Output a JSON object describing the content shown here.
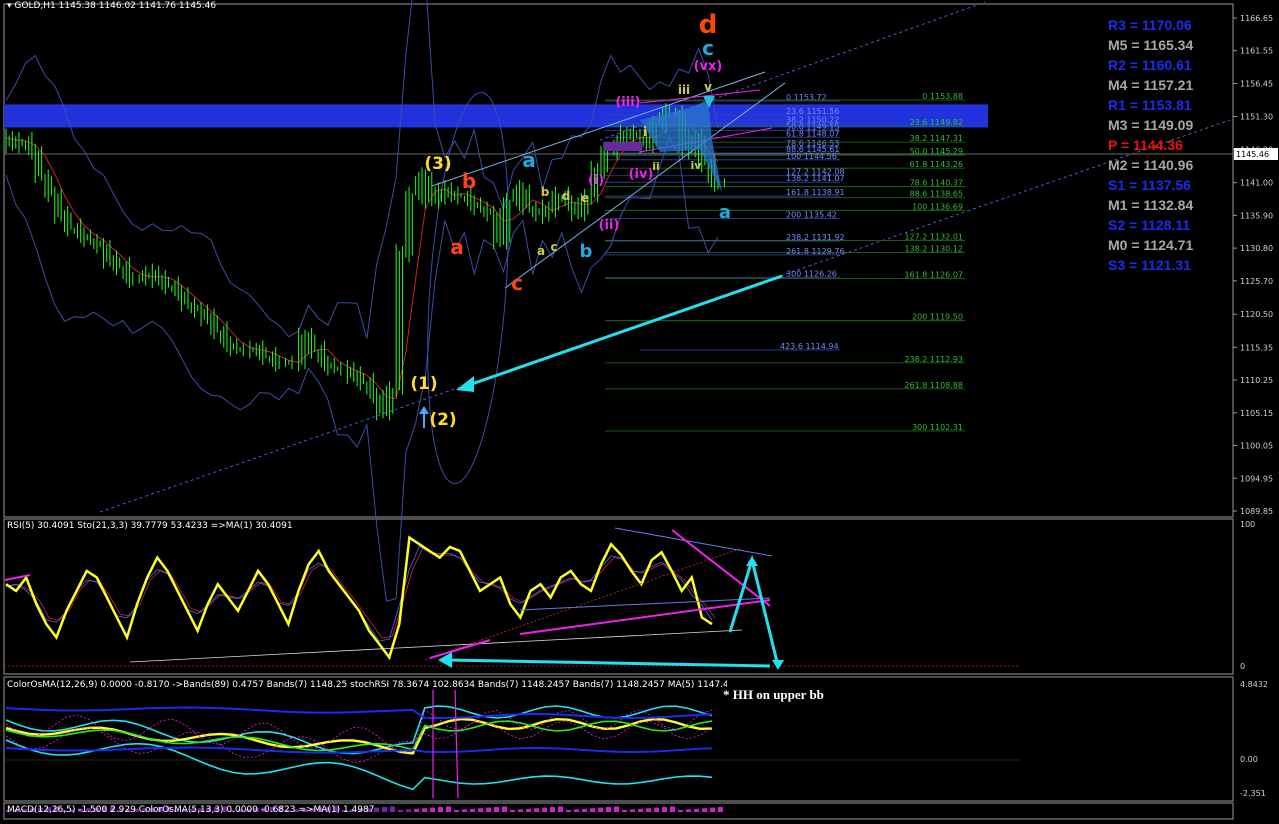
{
  "window": {
    "title": "GOLD,H1",
    "ohlc": "1145.38 1146.02 1141.76 1145.46",
    "current_price_tag": "1145.46"
  },
  "chart_data": [
    {
      "type": "line",
      "title": "GOLD,H1",
      "ylim": [
        1089.85,
        1168.5
      ],
      "y_ticks": [
        "1166.65",
        "1161.55",
        "1156.45",
        "1151.30",
        "1146.20",
        "1141.00",
        "1135.90",
        "1130.80",
        "1125.70",
        "1120.50",
        "1115.35",
        "1110.25",
        "1105.15",
        "1100.05",
        "1094.95",
        "1089.85"
      ],
      "price_path": [
        1148,
        1147,
        1147.5,
        1146,
        1142,
        1139,
        1136,
        1134,
        1133,
        1132,
        1131,
        1129,
        1128,
        1126,
        1126,
        1127,
        1126,
        1125,
        1124,
        1122,
        1121,
        1120,
        1118,
        1116,
        1115,
        1115,
        1115,
        1114,
        1113,
        1113,
        1113,
        1117,
        1115,
        1113,
        1112,
        1112,
        1111,
        1110,
        1108,
        1105,
        1109,
        1130,
        1139,
        1142,
        1138,
        1140,
        1139,
        1139,
        1138,
        1137,
        1136,
        1132,
        1138,
        1140,
        1137,
        1136,
        1137,
        1139,
        1138,
        1136,
        1139,
        1143,
        1146,
        1147,
        1149,
        1148,
        1147,
        1150,
        1152,
        1152,
        1146,
        1148,
        1144,
        1141
      ],
      "colors": {
        "pivot_line": "#2233dd",
        "candles": "#22ff22",
        "bands": "#3a4eaa",
        "wedge_fill": "#2a7acc"
      },
      "wave_labels": [
        {
          "text": "d",
          "color": "#ff4411"
        },
        {
          "text": "c",
          "color": "#1ea8e0"
        },
        {
          "text": "(vx)",
          "color": "#ee22ee"
        },
        {
          "text": "(iii)",
          "color": "#ee22ee"
        },
        {
          "text": "iii",
          "color": "#cccc44"
        },
        {
          "text": "v",
          "color": "#cccc44"
        },
        {
          "text": "i",
          "color": "#cccc44"
        },
        {
          "text": "ii",
          "color": "#cccc44"
        },
        {
          "text": "iv",
          "color": "#cccc44"
        },
        {
          "text": "(iv)",
          "color": "#ee22ee"
        },
        {
          "text": "(i)",
          "color": "#ee22ee"
        },
        {
          "text": "(ii)",
          "color": "#ee22ee"
        },
        {
          "text": "(3)",
          "color": "#ffdd22"
        },
        {
          "text": "b",
          "color": "#ff4411"
        },
        {
          "text": "a",
          "color": "#ff4411"
        },
        {
          "text": "a",
          "color": "#1ea8e0"
        },
        {
          "text": "b",
          "color": "#cccc44"
        },
        {
          "text": "d",
          "color": "#cccc44"
        },
        {
          "text": "a",
          "color": "#cccc44"
        },
        {
          "text": "c",
          "color": "#cccc44"
        },
        {
          "text": "e",
          "color": "#cccc44"
        },
        {
          "text": "b",
          "color": "#1ea8e0"
        },
        {
          "text": "c",
          "color": "#ff4411"
        },
        {
          "text": "a",
          "color": "#1ea8e0"
        },
        {
          "text": "(1)",
          "color": "#ffdd22"
        },
        {
          "text": "(2)",
          "color": "#ffdd22"
        }
      ],
      "fib_blue": [
        {
          "label": "0 1153.72",
          "y": 1153.72
        },
        {
          "label": "23.6 1151.56",
          "y": 1151.56
        },
        {
          "label": "38.2 1150.22",
          "y": 1150.22
        },
        {
          "label": "50.0 1149.15",
          "y": 1149.15
        },
        {
          "label": "61.8 1148.07",
          "y": 1148.07
        },
        {
          "label": "78.6 1146.53",
          "y": 1146.53
        },
        {
          "label": "88.6 1145.61",
          "y": 1145.61
        },
        {
          "label": "100 1144.56",
          "y": 1144.56
        },
        {
          "label": "127.2 1142.08",
          "y": 1142.08
        },
        {
          "label": "138.2 1141.07",
          "y": 1141.07
        },
        {
          "label": "161.8 1138.91",
          "y": 1138.91
        },
        {
          "label": "200 1135.42",
          "y": 1135.42
        },
        {
          "label": "238.2 1131.92",
          "y": 1131.92
        },
        {
          "label": "261.8 1129.76",
          "y": 1129.76
        },
        {
          "label": "300 1126.26",
          "y": 1126.26
        },
        {
          "label": "423.6 1114.94",
          "y": 1114.94
        }
      ],
      "fib_green": [
        {
          "label": "0 1153.88",
          "y": 1153.88
        },
        {
          "label": "23.6 1149.82",
          "y": 1149.82
        },
        {
          "label": "38.2 1147.31",
          "y": 1147.31
        },
        {
          "label": "50.0 1145.29",
          "y": 1145.29
        },
        {
          "label": "61.8 1143.26",
          "y": 1143.26
        },
        {
          "label": "78.6 1140.37",
          "y": 1140.37
        },
        {
          "label": "88.6 1138.65",
          "y": 1138.65
        },
        {
          "label": "100 1136.69",
          "y": 1136.69
        },
        {
          "label": "127.2 1132.01",
          "y": 1132.01
        },
        {
          "label": "138.2 1130.12",
          "y": 1130.12
        },
        {
          "label": "161.8 1126.07",
          "y": 1126.07
        },
        {
          "label": "200 1119.50",
          "y": 1119.5
        },
        {
          "label": "238.2 1112.93",
          "y": 1112.93
        },
        {
          "label": "261.8 1108.88",
          "y": 1108.88
        },
        {
          "label": "300 1102.31",
          "y": 1102.31
        }
      ]
    },
    {
      "type": "line",
      "title": "RSI(5) 30.4091  Sto(21,3,3) 39.7779 53.4233  =>MA(1) 30.4091",
      "ylim": [
        0,
        100
      ],
      "y_ticks": [
        "100",
        "0"
      ],
      "series": [
        {
          "values": [
            60,
            55,
            65,
            45,
            30,
            20,
            40,
            55,
            70,
            65,
            50,
            35,
            20,
            45,
            65,
            80,
            70,
            55,
            40,
            25,
            45,
            60,
            50,
            40,
            55,
            70,
            60,
            45,
            30,
            55,
            75,
            85,
            70,
            60,
            50,
            40,
            25,
            15,
            5,
            30,
            95,
            90,
            85,
            80,
            88,
            85,
            70,
            55,
            60,
            65,
            45,
            35,
            55,
            60,
            50,
            65,
            70,
            60,
            55,
            75,
            90,
            82,
            70,
            60,
            78,
            84,
            70,
            55,
            65,
            35,
            30
          ]
        }
      ]
    },
    {
      "type": "line",
      "title": "ColorOsMA(12,26,9) 0.0000 -0.8170  ->Bands(89) 0.4757  Bands(7) 1148.25  stochRSI 78.3674 102.8634  Bands(7) 1148.2457  Bands(7) 1148.2457  MA(5) 1147.4792",
      "y_ticks": [
        "4.8432",
        "0.00",
        "-2.351"
      ]
    }
  ],
  "pivots": [
    {
      "text": "R3 = 1170.06",
      "color": "#1a2cee"
    },
    {
      "text": "M5 = 1165.34",
      "color": "#a8a8a8"
    },
    {
      "text": "R2 = 1160.61",
      "color": "#1a2cee"
    },
    {
      "text": "M4 = 1157.21",
      "color": "#a8a8a8"
    },
    {
      "text": "R1 = 1153.81",
      "color": "#1a2cee"
    },
    {
      "text": "M3 = 1149.09",
      "color": "#a8a8a8"
    },
    {
      "text": "P  = 1144.36",
      "color": "#ee1111"
    },
    {
      "text": "M2 = 1140.96",
      "color": "#a8a8a8"
    },
    {
      "text": "S1 = 1137.56",
      "color": "#1a2cee"
    },
    {
      "text": "M1 = 1132.84",
      "color": "#a8a8a8"
    },
    {
      "text": "S2 = 1128.11",
      "color": "#1a2cee"
    },
    {
      "text": "M0 = 1124.71",
      "color": "#a8a8a8"
    },
    {
      "text": "S3 = 1121.31",
      "color": "#1a2cee"
    }
  ],
  "annotations": {
    "osma_note": "* HH on upper bb",
    "macd_header": "MACD(12,26,5) -1.500 2.929  ColorOsMA(5,13,3) 0.0000 -0.6823  =>MA(1) 1.4987"
  }
}
